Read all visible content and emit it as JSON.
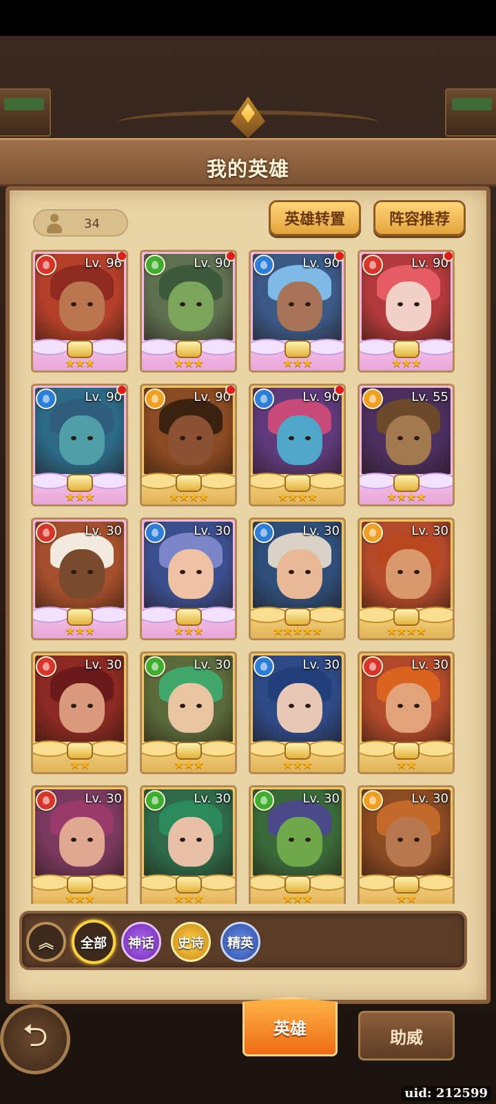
{
  "header": {
    "title": "我的英雄"
  },
  "hero_count": "34",
  "buttons": {
    "swap": "英雄转置",
    "recommend": "阵容推荐"
  },
  "colors": {
    "fire": "#d9342a",
    "nature": "#3fae2f",
    "water": "#2b7fd9",
    "light": "#f0a020",
    "mythic_frame": "#f3b6e2",
    "epic_frame": "#efc464"
  },
  "heroes": [
    {
      "level": "Lv. 96",
      "element": "fire",
      "rarity": "mythic",
      "stars": "★★★",
      "red_dot": true,
      "bg": "#b4402a",
      "skin": "#b9764f",
      "hair": "#8e2b1e"
    },
    {
      "level": "Lv. 90",
      "element": "nature",
      "rarity": "mythic",
      "stars": "★★★",
      "red_dot": true,
      "bg": "#5e7050",
      "skin": "#7aa55b",
      "hair": "#3c5a3a"
    },
    {
      "level": "Lv. 90",
      "element": "water",
      "rarity": "mythic",
      "stars": "★★★",
      "red_dot": true,
      "bg": "#3b5a86",
      "skin": "#a77457",
      "hair": "#7fb9e6"
    },
    {
      "level": "Lv. 90",
      "element": "fire",
      "rarity": "mythic",
      "stars": "★★★",
      "red_dot": true,
      "bg": "#b23a3a",
      "skin": "#f2d2c7",
      "hair": "#e55c62"
    },
    {
      "level": "Lv. 90",
      "element": "water",
      "rarity": "mythic",
      "stars": "★★★",
      "red_dot": true,
      "bg": "#2c6a86",
      "skin": "#4f9fa8",
      "hair": "#2f5e7d"
    },
    {
      "level": "Lv. 90",
      "element": "light",
      "rarity": "epic",
      "stars": "★★★★",
      "red_dot": true,
      "bg": "#8a4a22",
      "skin": "#8a5232",
      "hair": "#3a2210"
    },
    {
      "level": "Lv. 90",
      "element": "water",
      "rarity": "epic",
      "stars": "★★★★",
      "red_dot": true,
      "bg": "#5e3a7a",
      "skin": "#4ea7c9",
      "hair": "#c74a78"
    },
    {
      "level": "Lv. 55",
      "element": "light",
      "rarity": "mythic",
      "stars": "★★★★",
      "red_dot": false,
      "bg": "#4b2f5e",
      "skin": "#a27a4e",
      "hair": "#6a4a2a"
    },
    {
      "level": "Lv. 30",
      "element": "fire",
      "rarity": "mythic",
      "stars": "★★★",
      "red_dot": false,
      "bg": "#a5502c",
      "skin": "#7a4a2e",
      "hair": "#f2eadc"
    },
    {
      "level": "Lv. 30",
      "element": "water",
      "rarity": "mythic",
      "stars": "★★★",
      "red_dot": false,
      "bg": "#3b4f8e",
      "skin": "#f0c2a4",
      "hair": "#7a86c6"
    },
    {
      "level": "Lv. 30",
      "element": "water",
      "rarity": "epic",
      "stars": "★★★★★",
      "red_dot": false,
      "bg": "#2e4f7a",
      "skin": "#e9b896",
      "hair": "#d9d2c6"
    },
    {
      "level": "Lv. 30",
      "element": "light",
      "rarity": "epic",
      "stars": "★★★★",
      "red_dot": false,
      "bg": "#b34a2a",
      "skin": "#d9996c",
      "hair": "#b8461f"
    },
    {
      "level": "Lv. 30",
      "element": "fire",
      "rarity": "epic",
      "stars": "★★",
      "red_dot": false,
      "bg": "#8a2a22",
      "skin": "#d89a7a",
      "hair": "#6b1a1a"
    },
    {
      "level": "Lv. 30",
      "element": "nature",
      "rarity": "epic",
      "stars": "★★★",
      "red_dot": false,
      "bg": "#5a6a3a",
      "skin": "#e8c4a0",
      "hair": "#3fa86a"
    },
    {
      "level": "Lv. 30",
      "element": "water",
      "rarity": "epic",
      "stars": "★★★",
      "red_dot": false,
      "bg": "#2e4a86",
      "skin": "#e8c8b4",
      "hair": "#223f7a"
    },
    {
      "level": "Lv. 30",
      "element": "fire",
      "rarity": "epic",
      "stars": "★★",
      "red_dot": false,
      "bg": "#b04a2a",
      "skin": "#e0a37a",
      "hair": "#d9631f"
    },
    {
      "level": "Lv. 30",
      "element": "fire",
      "rarity": "epic",
      "stars": "★★★",
      "red_dot": false,
      "bg": "#7a3a5e",
      "skin": "#e0a890",
      "hair": "#9a3a6a"
    },
    {
      "level": "Lv. 30",
      "element": "nature",
      "rarity": "epic",
      "stars": "★★★",
      "red_dot": false,
      "bg": "#2e6a4a",
      "skin": "#e8c0a8",
      "hair": "#2a8a5a"
    },
    {
      "level": "Lv. 30",
      "element": "nature",
      "rarity": "epic",
      "stars": "★★★",
      "red_dot": false,
      "bg": "#3a6a3a",
      "skin": "#6fa84a",
      "hair": "#4a4a8a"
    },
    {
      "level": "Lv. 30",
      "element": "light",
      "rarity": "epic",
      "stars": "★★",
      "red_dot": false,
      "bg": "#8a4a22",
      "skin": "#b8784e",
      "hair": "#c26a2a"
    }
  ],
  "filters": {
    "collapse_icon": "chevron-up-double-icon",
    "all": "全部",
    "mythic": "神话",
    "epic": "史诗",
    "elite": "精英"
  },
  "tabs": {
    "heroes": "英雄",
    "support": "助威"
  },
  "uid": "uid: 212599"
}
